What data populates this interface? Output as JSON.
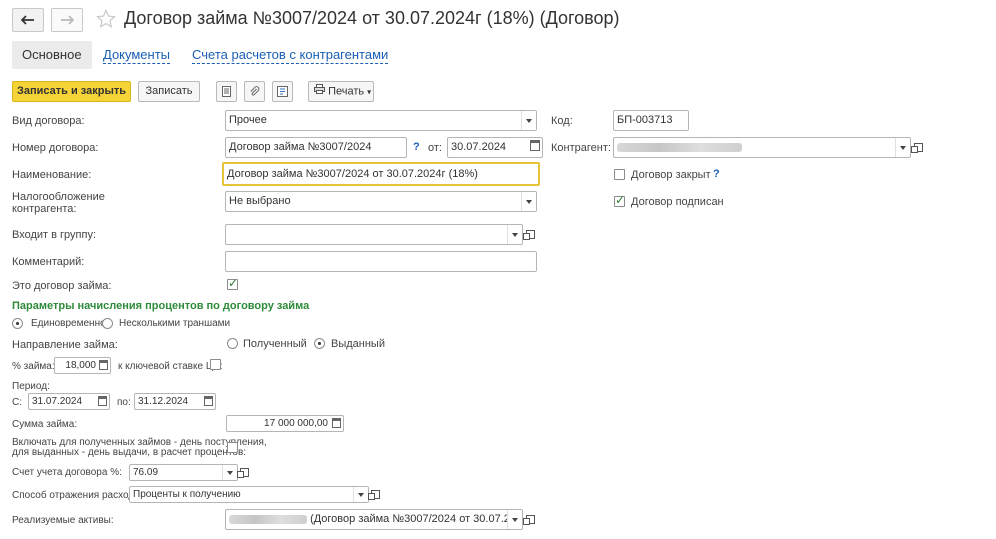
{
  "window": {
    "title": "Договор займа №3007/2024 от 30.07.2024г (18%) (Договор)"
  },
  "tabs": [
    {
      "label": "Основное",
      "active": true
    },
    {
      "label": "Документы",
      "active": false
    },
    {
      "label": "Счета расчетов с контрагентами",
      "active": false
    }
  ],
  "toolbar": {
    "save_close_label": "Записать и закрыть",
    "save_label": "Записать",
    "print_label": "Печать"
  },
  "form": {
    "contract_type_label": "Вид договора:",
    "contract_type_value": "Прочее",
    "code_label": "Код:",
    "code_value": "БП-003713",
    "number_label": "Номер договора:",
    "number_value": "Договор займа №3007/2024",
    "help_mark": "?",
    "date_from_label": "от:",
    "date_value": "30.07.2024",
    "counterparty_label": "Контрагент:",
    "name_label": "Наименование:",
    "name_value": "Договор займа №3007/2024 от 30.07.2024г (18%)",
    "closed_label": "Договор закрыт",
    "taxation_label": "Налогообложение контрагента:",
    "taxation_value": "Не выбрано",
    "signed_label": "Договор подписан",
    "group_label": "Входит в группу:",
    "group_value": "",
    "comment_label": "Комментарий:",
    "comment_value": "",
    "is_loan_label": "Это договор займа:"
  },
  "loan": {
    "section_title": "Параметры начисления процентов по договору займа",
    "once_label": "Единовременно",
    "tranches_label": "Несколькими траншами",
    "direction_label": "Направление займа:",
    "received_label": "Полученный",
    "issued_label": "Выданный",
    "percent_label": "% займа:",
    "percent_value": "18,000",
    "key_rate_label": "к ключевой ставке ЦБ:",
    "period_label": "Период:",
    "from_label": "С:",
    "from_value": "31.07.2024",
    "to_label": "по:",
    "to_value": "31.12.2024",
    "sum_label": "Сумма займа:",
    "sum_value": "17 000 000,00",
    "include_label_line1": "Включать для полученных займов - день поступления,",
    "include_label_line2": "для выданных - день выдачи, в расчет процентов:",
    "account_label": "Счет учета договора %:",
    "account_value": "76.09",
    "expense_label": "Способ отражения расходов:",
    "expense_value": "Проценты к получению",
    "assets_label": "Реализуемые активы:",
    "assets_value": "(Договор займа №3007/2024 от 30.07.2"
  }
}
